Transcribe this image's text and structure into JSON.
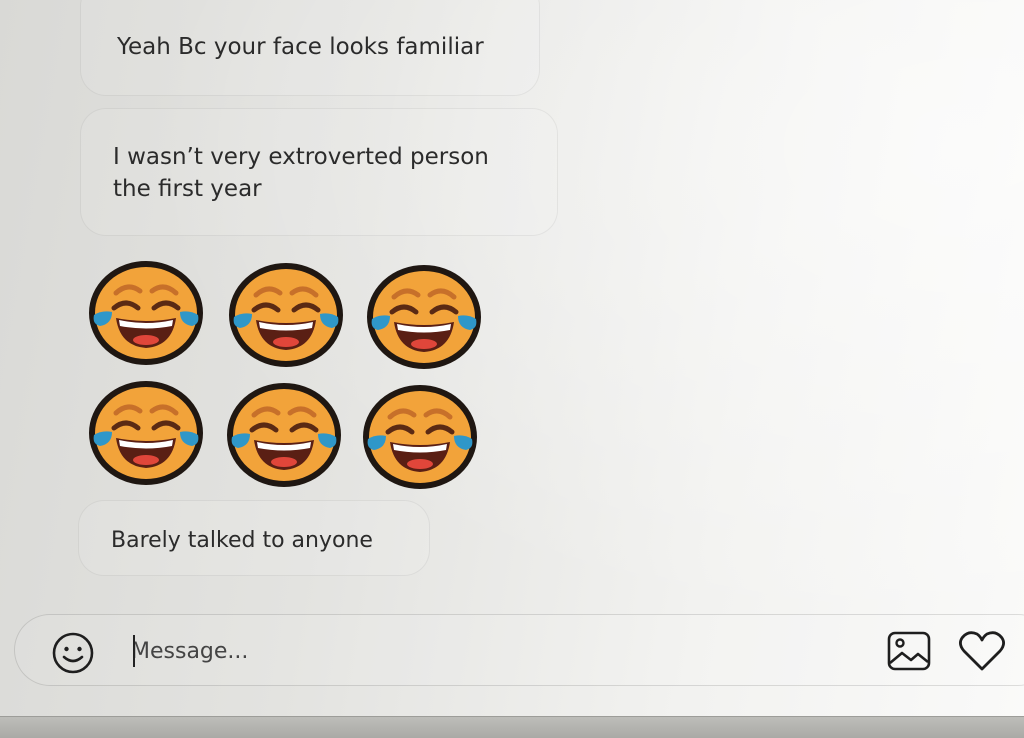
{
  "messages": [
    {
      "lines": [
        "Yeah Bc your face looks familiar"
      ]
    },
    {
      "lines": [
        "I wasn’t very extroverted person",
        "the first year"
      ]
    },
    {
      "lines": [
        "Barely talked to anyone"
      ]
    }
  ],
  "emoji_message": {
    "icon": "face-with-tears-of-joy-icon",
    "count": 6,
    "colors": {
      "face": "#f2a33a",
      "outline": "#1f1712",
      "tears": "#2f97c9",
      "mouth": "#5a1f14",
      "teeth": "#ffffff"
    }
  },
  "composer": {
    "placeholder": "Message...",
    "left_icon": "smiley-icon",
    "right_icons": [
      "image-icon",
      "heart-icon"
    ]
  }
}
